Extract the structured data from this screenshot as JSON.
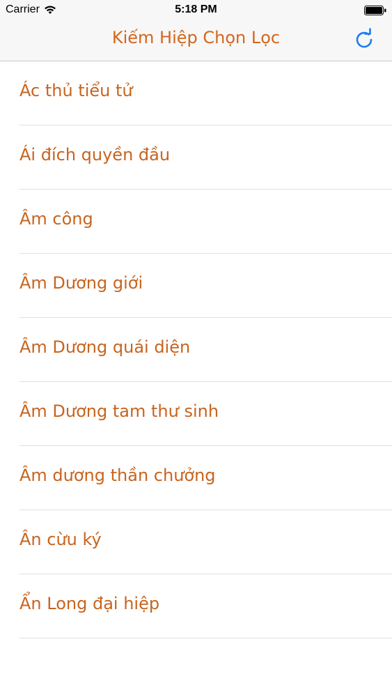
{
  "status_bar": {
    "carrier": "Carrier",
    "time": "5:18 PM",
    "wifi_icon": "wifi-icon",
    "battery_icon": "battery-icon"
  },
  "nav": {
    "title": "Kiếm Hiệp Chọn Lọc",
    "refresh_icon": "refresh-icon"
  },
  "colors": {
    "accent": "#d4661c",
    "item_text": "#c8641e",
    "ios_blue": "#1a7cf5"
  },
  "list": {
    "items": [
      "Ác thủ tiểu tử",
      "Ái đích quyền đầu",
      "Âm công",
      "Âm Dương giới",
      "Âm Dương quái diện",
      "Âm Dương tam thư sinh",
      "Âm dương thần chưởng",
      "Ân cừu ký",
      "Ẩn Long đại hiệp"
    ]
  }
}
